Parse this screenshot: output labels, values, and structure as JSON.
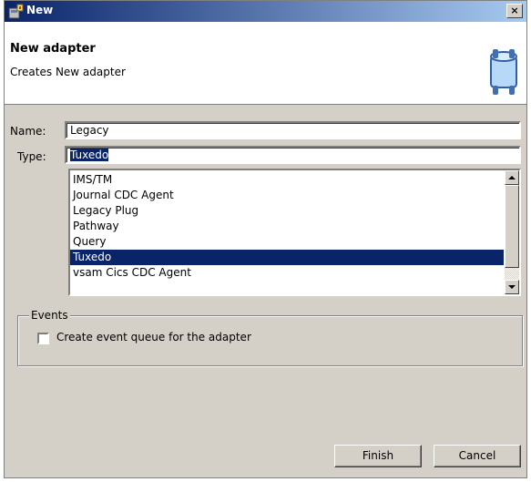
{
  "window": {
    "title": "New",
    "close_label": "×"
  },
  "banner": {
    "title": "New adapter",
    "description": "Creates New adapter",
    "icon": "adapter-icon"
  },
  "form": {
    "name_label": "Name:",
    "name_value": "Legacy",
    "type_label": "Type:",
    "type_value": "Tuxedo"
  },
  "type_list": {
    "items": [
      "IMS/TM",
      "Journal CDC Agent",
      "Legacy Plug",
      "Pathway",
      "Query",
      "Tuxedo",
      "vsam Cics CDC Agent"
    ],
    "selected": "Tuxedo"
  },
  "events": {
    "group_label": "Events",
    "checkbox_label": "Create event queue for the adapter",
    "checked": false
  },
  "buttons": {
    "finish": "Finish",
    "cancel": "Cancel"
  },
  "colors": {
    "title_bar": "#0a246a",
    "selection": "#0a246a",
    "dialog_bg": "#d4d0c8"
  }
}
